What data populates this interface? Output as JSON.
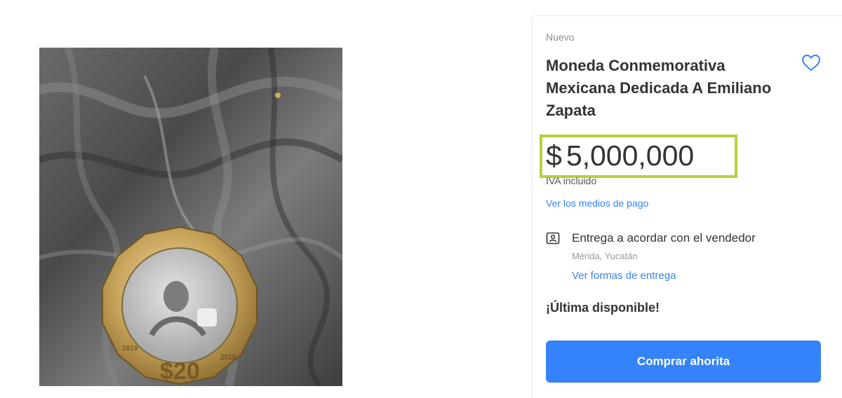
{
  "product": {
    "condition": "Nuevo",
    "title": "Moneda Conmemorativa Mexicana Dedicada A Emiliano Zapata",
    "price_currency": "$",
    "price_amount": "5,000,000",
    "tax_note": "IVA incluido",
    "payment_link": "Ver los medios de pago",
    "shipping": {
      "title": "Entrega a acordar con el vendedor",
      "location": "Mérida, Yucatán",
      "link": "Ver formas de entrega"
    },
    "stock_status": "¡Última disponible!",
    "buy_button": "Comprar ahorita"
  },
  "image": {
    "coin_denomination": "$20",
    "coin_years": [
      "1919",
      "2019"
    ]
  },
  "colors": {
    "accent_blue": "#3483fa",
    "highlight_green": "#b4d23a",
    "text_dark": "#333333",
    "text_muted": "#999999"
  },
  "icons": {
    "favorite": "heart-outline-icon",
    "shipping": "id-card-icon"
  }
}
